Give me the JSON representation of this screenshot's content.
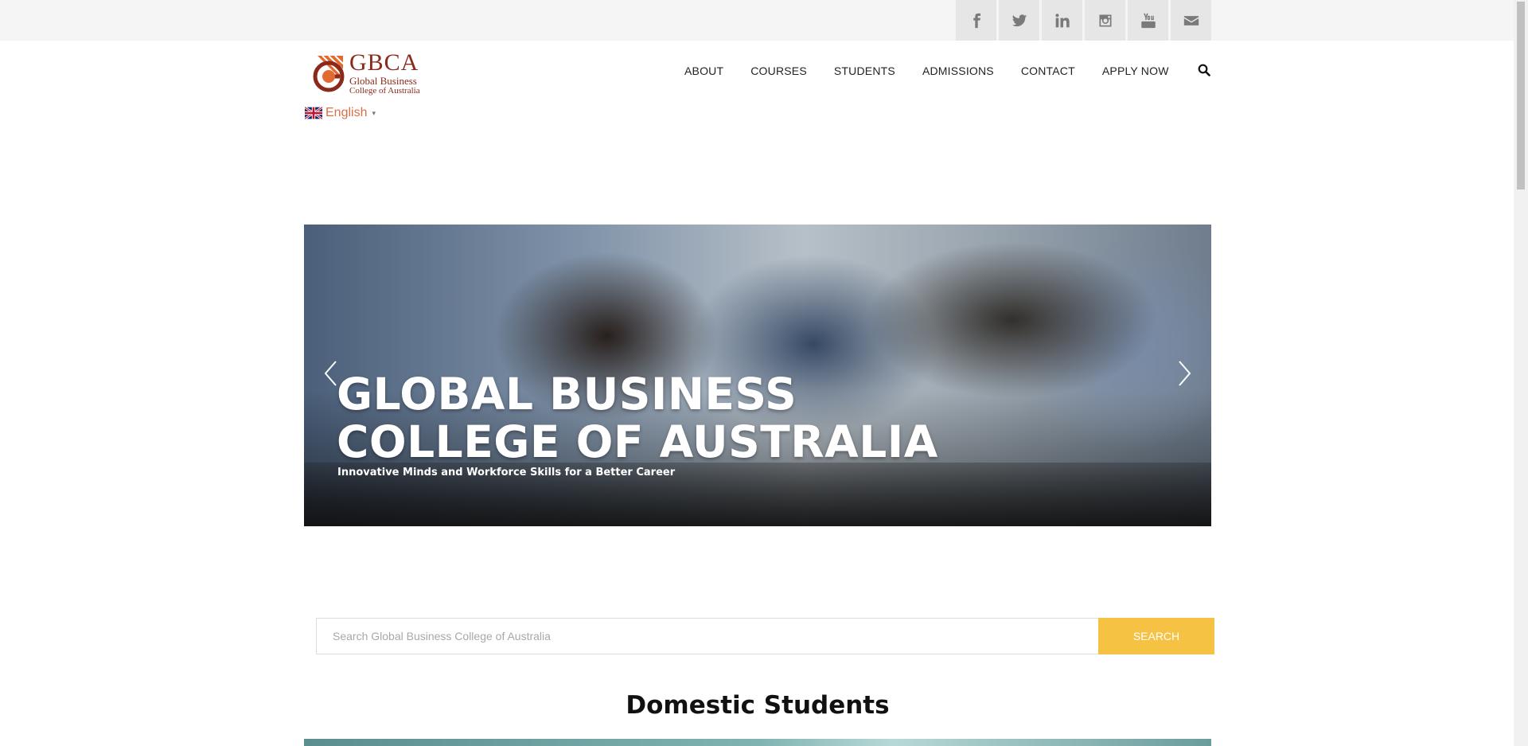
{
  "social": {
    "items": [
      {
        "name": "facebook"
      },
      {
        "name": "twitter"
      },
      {
        "name": "linkedin"
      },
      {
        "name": "instagram"
      },
      {
        "name": "youtube"
      },
      {
        "name": "email"
      }
    ]
  },
  "header": {
    "logo": {
      "abbr": "GBCA",
      "line1": "Global Business",
      "line2": "College of Australia"
    },
    "nav": [
      "ABOUT",
      "COURSES",
      "STUDENTS",
      "ADMISSIONS",
      "CONTACT",
      "APPLY NOW"
    ],
    "language": {
      "label": "English",
      "caret": "▾"
    }
  },
  "hero": {
    "title_line1": "GLOBAL BUSINESS",
    "title_line2": "COLLEGE OF AUSTRALIA",
    "subtitle": "Innovative Minds and Workforce Skills for a Better Career"
  },
  "search": {
    "placeholder": "Search Global Business College of Australia",
    "button": "SEARCH"
  },
  "section": {
    "title": "Domestic Students"
  },
  "colors": {
    "brand": "#8b2a1c",
    "accent": "#f6c244",
    "language": "#d9704a"
  }
}
